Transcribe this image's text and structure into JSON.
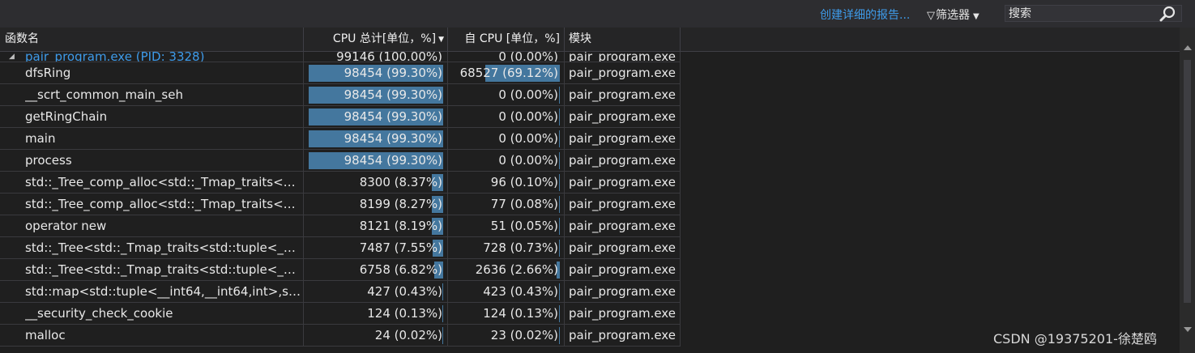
{
  "toolbar": {
    "report_link": "创建详细的报告...",
    "filter_label": "筛选器",
    "search_placeholder": "搜索"
  },
  "columns": {
    "function_name": "函数名",
    "cpu_total": "CPU 总计[单位，%]",
    "cpu_self": "自 CPU [单位，%]",
    "module": "模块"
  },
  "rows": [
    {
      "name": "pair_program.exe (PID: 3328)",
      "total": "99146 (100.00%)",
      "total_pct": 100.0,
      "self": "0 (0.00%)",
      "self_pct": 0.0,
      "module": "pair_program.exe"
    },
    {
      "name": "dfsRing",
      "total": "98454 (99.30%)",
      "total_pct": 99.3,
      "self": "68527 (69.12%)",
      "self_pct": 69.12,
      "module": "pair_program.exe"
    },
    {
      "name": "__scrt_common_main_seh",
      "total": "98454 (99.30%)",
      "total_pct": 99.3,
      "self": "0 (0.00%)",
      "self_pct": 0.0,
      "module": "pair_program.exe"
    },
    {
      "name": "getRingChain",
      "total": "98454 (99.30%)",
      "total_pct": 99.3,
      "self": "0 (0.00%)",
      "self_pct": 0.0,
      "module": "pair_program.exe"
    },
    {
      "name": "main",
      "total": "98454 (99.30%)",
      "total_pct": 99.3,
      "self": "0 (0.00%)",
      "self_pct": 0.0,
      "module": "pair_program.exe"
    },
    {
      "name": "process",
      "total": "98454 (99.30%)",
      "total_pct": 99.3,
      "self": "0 (0.00%)",
      "self_pct": 0.0,
      "module": "pair_program.exe"
    },
    {
      "name": "std::_Tree_comp_alloc<std::_Tmap_traits<std:...",
      "total": "8300 (8.37%)",
      "total_pct": 8.37,
      "self": "96 (0.10%)",
      "self_pct": 0.1,
      "module": "pair_program.exe"
    },
    {
      "name": "std::_Tree_comp_alloc<std::_Tmap_traits<std:...",
      "total": "8199 (8.27%)",
      "total_pct": 8.27,
      "self": "77 (0.08%)",
      "self_pct": 0.08,
      "module": "pair_program.exe"
    },
    {
      "name": "operator new",
      "total": "8121 (8.19%)",
      "total_pct": 8.19,
      "self": "51 (0.05%)",
      "self_pct": 0.05,
      "module": "pair_program.exe"
    },
    {
      "name": "std::_Tree<std::_Tmap_traits<std::tuple<__int...",
      "total": "7487 (7.55%)",
      "total_pct": 7.55,
      "self": "728 (0.73%)",
      "self_pct": 0.73,
      "module": "pair_program.exe"
    },
    {
      "name": "std::_Tree<std::_Tmap_traits<std::tuple<__int...",
      "total": "6758 (6.82%)",
      "total_pct": 6.82,
      "self": "2636 (2.66%)",
      "self_pct": 2.66,
      "module": "pair_program.exe"
    },
    {
      "name": "std::map<std::tuple<__int64,__int64,int>,std::...",
      "total": "427 (0.43%)",
      "total_pct": 0.43,
      "self": "423 (0.43%)",
      "self_pct": 0.43,
      "module": "pair_program.exe"
    },
    {
      "name": "__security_check_cookie",
      "total": "124 (0.13%)",
      "total_pct": 0.13,
      "self": "124 (0.13%)",
      "self_pct": 0.13,
      "module": "pair_program.exe"
    },
    {
      "name": "malloc",
      "total": "24 (0.02%)",
      "total_pct": 0.02,
      "self": "23 (0.02%)",
      "self_pct": 0.02,
      "module": "pair_program.exe"
    }
  ],
  "watermark": "CSDN @19375201-徐楚鸥",
  "colors": {
    "bar": "#44779e",
    "link": "#3e9bea",
    "background": "#1f1f1f"
  }
}
